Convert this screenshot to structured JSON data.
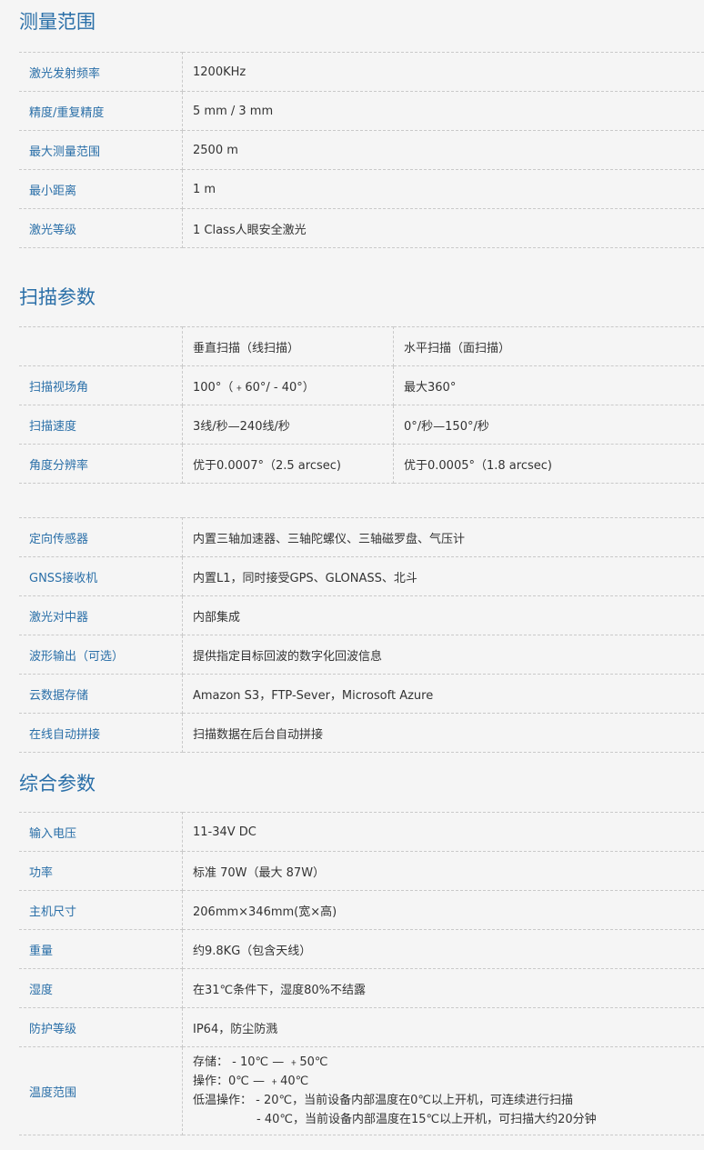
{
  "measure": {
    "title": "测量范围",
    "rows": [
      {
        "label": "激光发射频率",
        "value": "1200KHz"
      },
      {
        "label": "精度/重复精度",
        "value": "5 mm / 3 mm"
      },
      {
        "label": "最大测量范围",
        "value": "2500 m"
      },
      {
        "label": "最小距离",
        "value": "1 m"
      },
      {
        "label": "激光等级",
        "value": "1 Class人眼安全激光"
      }
    ]
  },
  "scan": {
    "title": "扫描参数",
    "header": {
      "label": "",
      "col1": "垂直扫描（线扫描）",
      "col2": "水平扫描（面扫描）"
    },
    "rows": [
      {
        "label": "扫描视场角",
        "col1": "100°（﹢60°/ - 40°）",
        "col2": "最大360°"
      },
      {
        "label": "扫描速度",
        "col1": "3线/秒—240线/秒",
        "col2": "0°/秒—150°/秒"
      },
      {
        "label": "角度分辨率",
        "col1": "优于0.0007°（2.5 arcsec)",
        "col2": "优于0.0005°（1.8 arcsec)"
      }
    ]
  },
  "misc": {
    "rows": [
      {
        "label": "定向传感器",
        "value": "内置三轴加速器、三轴陀螺仪、三轴磁罗盘、气压计"
      },
      {
        "label": "GNSS接收机",
        "value": "内置L1，同时接受GPS、GLONASS、北斗"
      },
      {
        "label": "激光对中器",
        "value": "内部集成"
      },
      {
        "label": "波形输出（可选）",
        "value": "提供指定目标回波的数字化回波信息"
      },
      {
        "label": "云数据存储",
        "value": "Amazon S3，FTP-Sever，Microsoft Azure"
      },
      {
        "label": "在线自动拼接",
        "value": "扫描数据在后台自动拼接"
      }
    ]
  },
  "general": {
    "title": "综合参数",
    "rows": [
      {
        "label": "输入电压",
        "value": "11-34V DC"
      },
      {
        "label": "功率",
        "value": "标准 70W（最大 87W）"
      },
      {
        "label": "主机尺寸",
        "value": "206mm×346mm(宽×高)"
      },
      {
        "label": "重量",
        "value": "约9.8KG（包含天线）"
      },
      {
        "label": "湿度",
        "value": "在31℃条件下，湿度80%不结露"
      },
      {
        "label": "防护等级",
        "value": "IP64，防尘防溅"
      }
    ],
    "temperature": {
      "label": "温度范围",
      "lines": [
        "存储： - 10℃ — ﹢50℃",
        "操作：0℃ — ﹢40℃",
        "低温操作： - 20℃，当前设备内部温度在0℃以上开机，可连续进行扫描",
        "- 40℃，当前设备内部温度在15℃以上开机，可扫描大约20分钟"
      ]
    }
  }
}
